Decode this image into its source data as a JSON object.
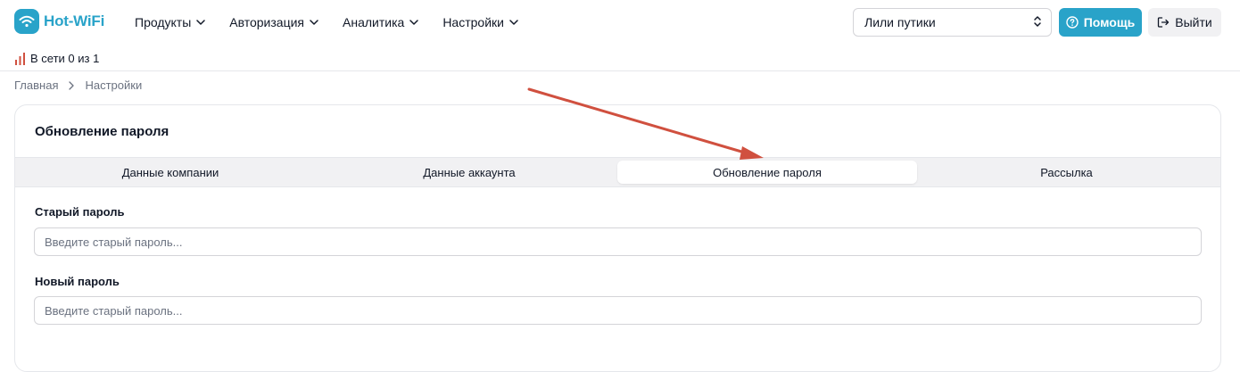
{
  "app": {
    "logo_text": "Hot-WiFi",
    "brand_color": "#29a3c9"
  },
  "nav": {
    "items": [
      {
        "label": "Продукты"
      },
      {
        "label": "Авторизация"
      },
      {
        "label": "Аналитика"
      },
      {
        "label": "Настройки"
      }
    ]
  },
  "company_select": {
    "value": "Лили путики"
  },
  "help_button": {
    "label": "Помощь"
  },
  "logout_button": {
    "label": "Выйти"
  },
  "status": {
    "text": "В сети 0 из 1",
    "icon": "signal-bars-icon"
  },
  "breadcrumb": {
    "items": [
      "Главная",
      "Настройки"
    ]
  },
  "card": {
    "title": "Обновление пароля",
    "tabs": [
      {
        "label": "Данные компании",
        "active": false
      },
      {
        "label": "Данные аккаунта",
        "active": false
      },
      {
        "label": "Обновление пароля",
        "active": true
      },
      {
        "label": "Рассылка",
        "active": false
      }
    ],
    "fields": [
      {
        "label": "Старый пароль",
        "placeholder": "Введите старый пароль...",
        "value": ""
      },
      {
        "label": "Новый пароль",
        "placeholder": "Введите старый пароль...",
        "value": ""
      }
    ]
  },
  "annotation": {
    "arrow_color": "#d0503f"
  }
}
